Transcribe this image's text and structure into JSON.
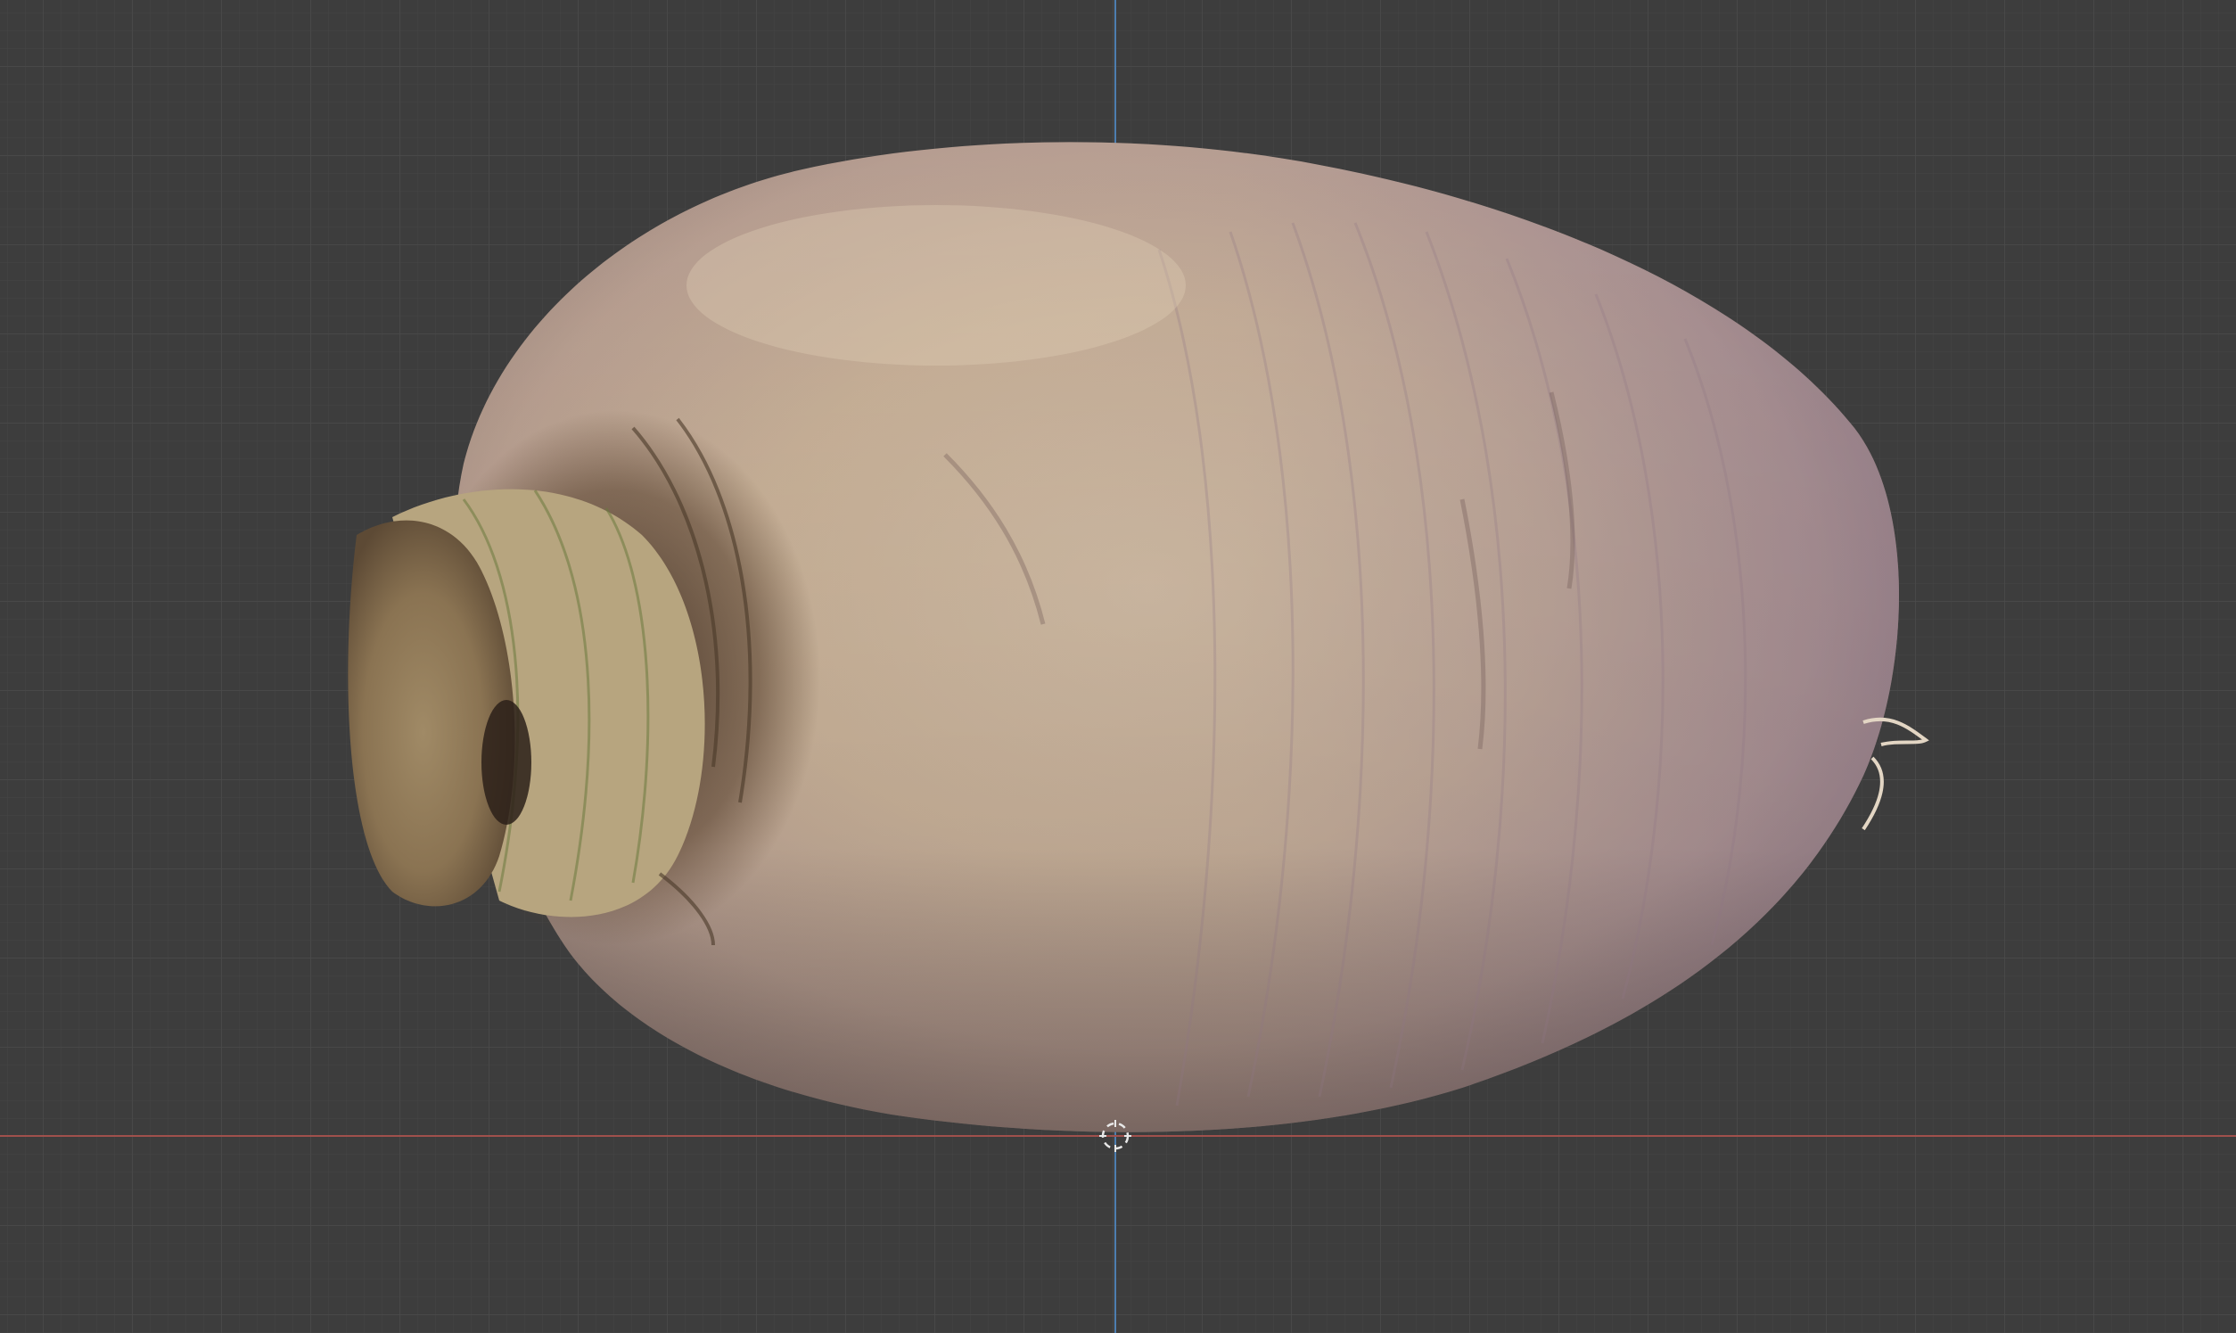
{
  "viewport": {
    "background_color": "#3d3d3d",
    "grid_minor_color": "#454545",
    "grid_major_color": "#4a4a4a",
    "x_axis_color": "#a0504c",
    "z_axis_color": "#4d7eb0",
    "cursor_color": "#e8e8e8"
  },
  "object": {
    "kind": "rutabaga-scan-mesh",
    "skin_color": "#cdb79a",
    "purple_tint_color": "#9a829b",
    "stem_color": "#5a4330",
    "root_crown_color": "#b7a57f"
  },
  "icons": {
    "cursor": "3d-cursor-icon"
  }
}
